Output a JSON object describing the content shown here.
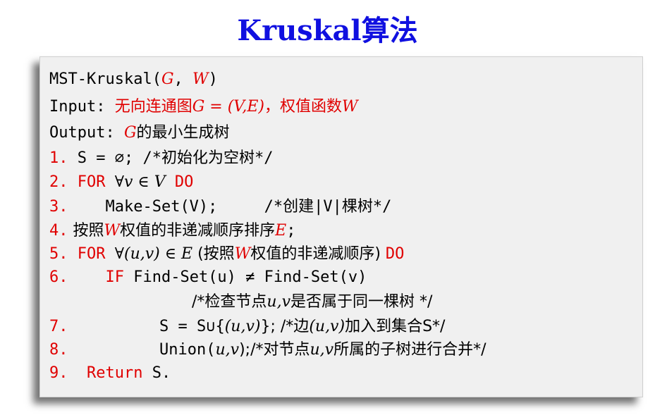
{
  "title": "Kruskal算法",
  "colors": {
    "title": "#1010e0",
    "keyword": "#e00000",
    "text": "#000000",
    "box": "#f0f0f0"
  },
  "code": {
    "l0": {
      "a": "MST-Kruskal(",
      "G": "G",
      "comma": ", ",
      "W": "W",
      "b": ")"
    },
    "l1": {
      "a": "Input: ",
      "b": "无向连通图",
      "m1": "G = (V,E)",
      "c": "，权值函数",
      "m2": "W"
    },
    "l2": {
      "a": "Output: ",
      "m": "G",
      "b": "的最小生成树"
    },
    "l3": {
      "n": "1.",
      "a": " S = ∅; /*初始化为空树*/"
    },
    "l4": {
      "n": "2.",
      "kw1": " FOR ",
      "m": "∀v ∈ V",
      "kw2": " DO"
    },
    "l5": {
      "n": "3.",
      "a": "    Make-Set(V);     /*创建|V|棵树*/"
    },
    "l6": {
      "n": "4.",
      "a": " 按照",
      "m1": "W",
      "b": "权值的非递减顺序排序",
      "m2": "E",
      "c": ";"
    },
    "l7": {
      "n": "5.",
      "kw1": " FOR ",
      "m1": "∀(u,v) ∈ E",
      "a": " (按照",
      "m2": "W",
      "b": "权值的非递减顺序) ",
      "kw2": "DO"
    },
    "l8": {
      "n": "6.",
      "kw": "    IF",
      "a": " Find-Set(u) ≠ Find-Set(v)"
    },
    "l9": {
      "a": "/*检查节点",
      "m": "u,v",
      "b": "是否属于同一棵树 */"
    },
    "l10": {
      "n": "7.",
      "a": "S = S∪{",
      "m": "(u,v)",
      "b": "}; /*边",
      "m2": "(u,v)",
      "c": "加入到集合S*/"
    },
    "l11": {
      "n": "8.",
      "a": "Union(",
      "m": "u,v",
      "b": ");/*对节点",
      "m2": "u,v",
      "c": "所属的子树进行合并*/"
    },
    "l12": {
      "n": "9.",
      "kw": "  Return",
      "a": " S."
    }
  }
}
